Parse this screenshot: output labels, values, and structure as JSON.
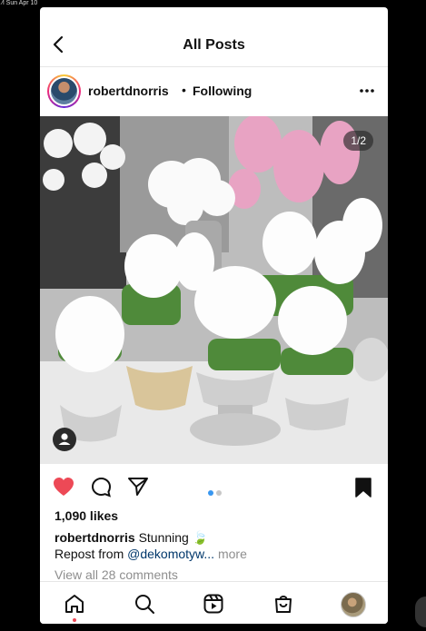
{
  "status_bar": {
    "text": "⁄l  Sun Apr 10"
  },
  "header": {
    "title": "All Posts",
    "back_icon": "chevron-left-icon"
  },
  "post": {
    "username": "robertdnorris",
    "separator": "•",
    "follow_status": "Following",
    "more_icon": "three-dots-icon",
    "image_counter": "1/2",
    "image_description_icon": "user-tag-icon",
    "carousel": {
      "current": 1,
      "total": 2
    },
    "likes": "1,090 likes",
    "caption": {
      "username": "robertdnorris",
      "text": "Stunning 🍃"
    },
    "repost": {
      "prefix": "Repost from ",
      "mention": "@dekomotyw...",
      "more": "more"
    },
    "view_comments": "View all 28 comments",
    "liked": true,
    "saved": true
  },
  "bottom_nav": {
    "items": [
      {
        "name": "home-icon",
        "active": true
      },
      {
        "name": "search-icon"
      },
      {
        "name": "reels-icon"
      },
      {
        "name": "shop-icon"
      },
      {
        "name": "profile-avatar"
      }
    ]
  },
  "colors": {
    "like_red": "#ed4956",
    "carousel_active": "#3897f0",
    "carousel_inactive": "#c7c7c7",
    "mention_blue": "#00376b",
    "muted_gray": "#8e8e8e"
  }
}
